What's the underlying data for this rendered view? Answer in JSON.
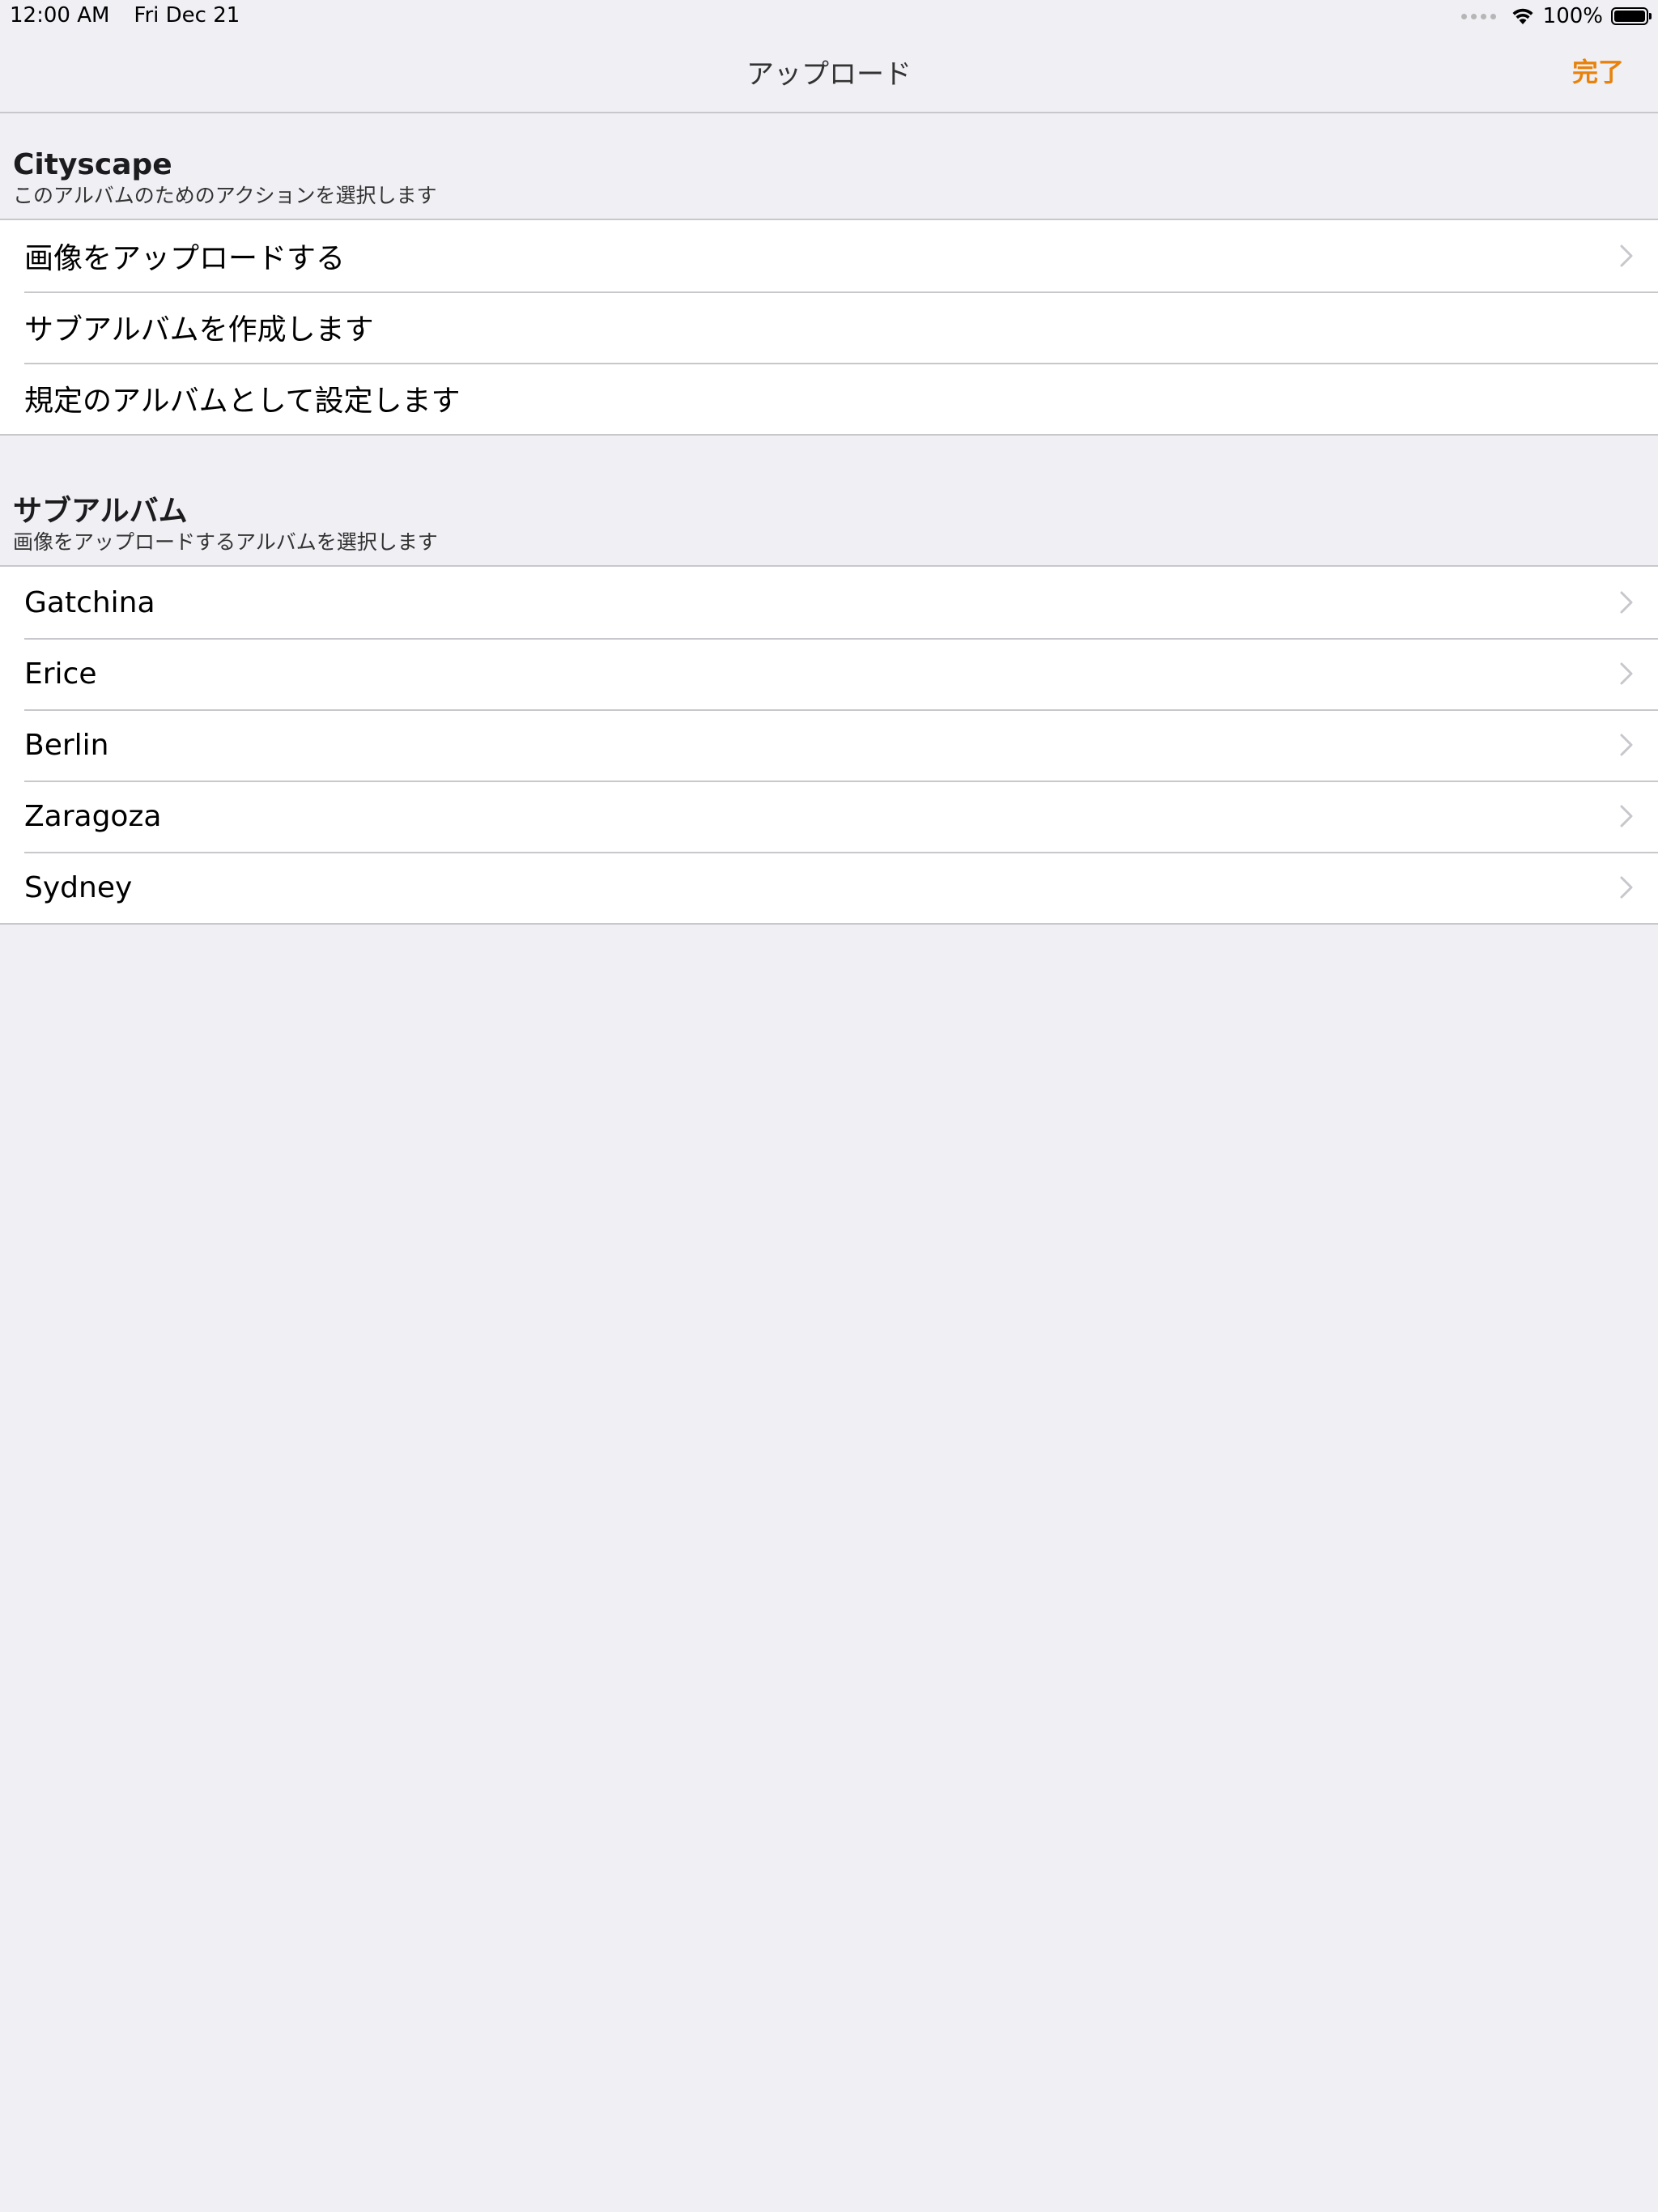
{
  "status_bar": {
    "time": "12:00 AM",
    "date": "Fri Dec 21",
    "battery": "100%"
  },
  "nav": {
    "title": "アップロード",
    "done_label": "完了"
  },
  "album_section": {
    "title": "Cityscape",
    "subtitle": "このアルバムのためのアクションを選択します",
    "items": [
      {
        "label": "画像をアップロードする",
        "chevron": true
      },
      {
        "label": "サブアルバムを作成します",
        "chevron": false
      },
      {
        "label": "規定のアルバムとして設定します",
        "chevron": false
      }
    ]
  },
  "subalbum_section": {
    "title": "サブアルバム",
    "subtitle": "画像をアップロードするアルバムを選択します",
    "items": [
      {
        "label": "Gatchina"
      },
      {
        "label": "Erice"
      },
      {
        "label": "Berlin"
      },
      {
        "label": "Zaragoza"
      },
      {
        "label": "Sydney"
      }
    ]
  },
  "colors": {
    "accent": "#e8820c",
    "background": "#efeff4",
    "separator": "#c8c7cc",
    "chevron": "#c7c7cc"
  }
}
